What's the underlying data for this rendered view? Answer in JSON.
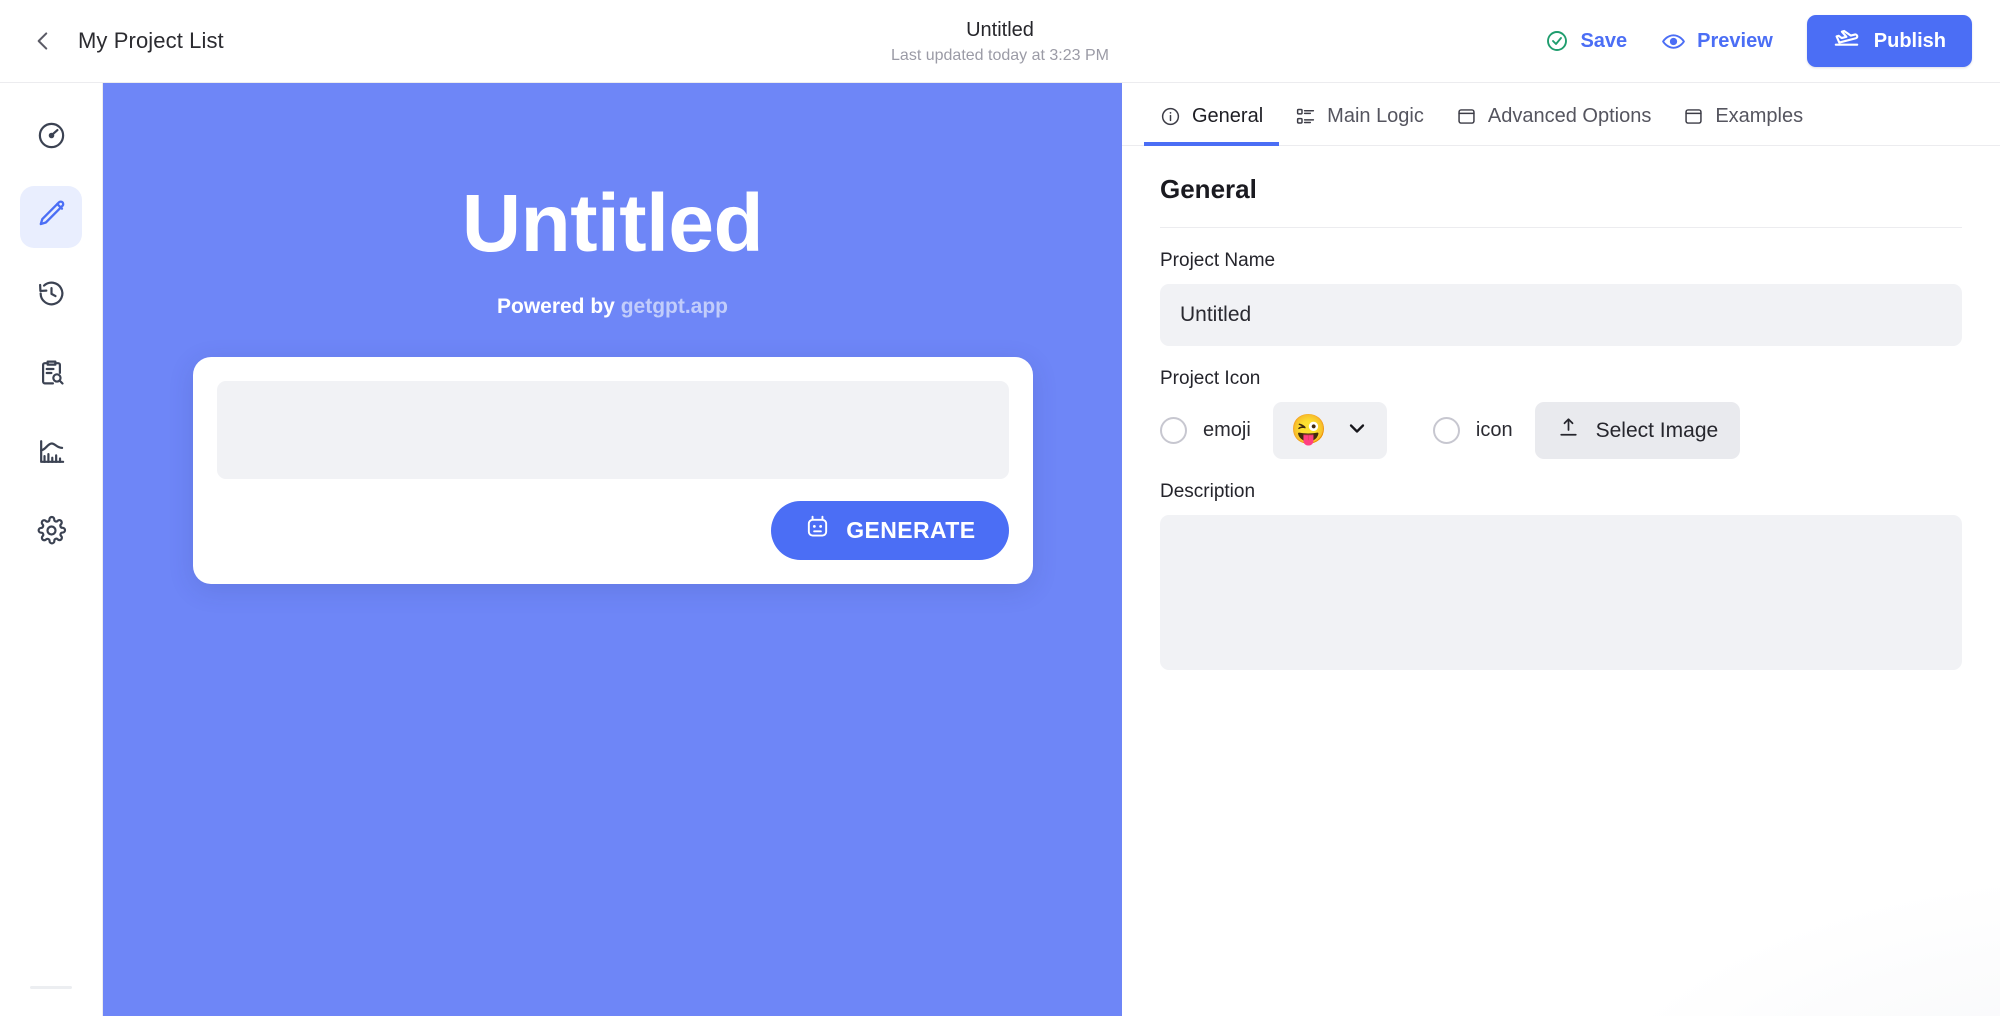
{
  "header": {
    "back_icon": "chevron-left-icon",
    "breadcrumb": "My Project List",
    "doc_title": "Untitled",
    "doc_subtitle": "Last updated today at 3:23 PM",
    "save_label": "Save",
    "save_icon": "check-circle-icon",
    "preview_label": "Preview",
    "preview_icon": "eye-icon",
    "publish_label": "Publish",
    "publish_icon": "plane-takeoff-icon",
    "accent_color": "#4b6ef5",
    "save_icon_color": "#1f9d6e"
  },
  "sidebar": {
    "items": [
      {
        "name": "dashboard",
        "icon": "speedometer-icon",
        "active": false
      },
      {
        "name": "editor",
        "icon": "pencil-icon",
        "active": true
      },
      {
        "name": "history",
        "icon": "clock-rewind-icon",
        "active": false
      },
      {
        "name": "logs",
        "icon": "clipboard-search-icon",
        "active": false
      },
      {
        "name": "analytics",
        "icon": "bar-chart-icon",
        "active": false
      },
      {
        "name": "settings",
        "icon": "gear-icon",
        "active": false
      }
    ],
    "active_bg": "#e9eefe",
    "active_fg": "#4b6ef5"
  },
  "preview": {
    "title": "Untitled",
    "powered_by_prefix": "Powered by ",
    "powered_by_brand": "getgpt.app",
    "prompt_value": "",
    "generate_label": "GENERATE",
    "generate_icon": "robot-icon",
    "background_color": "#6e86f7",
    "brand_color": "#c2cdfb"
  },
  "inspector": {
    "tabs": [
      {
        "label": "General",
        "icon": "info-circle-icon",
        "active": true
      },
      {
        "label": "Main Logic",
        "icon": "list-checks-icon",
        "active": false
      },
      {
        "label": "Advanced Options",
        "icon": "window-icon",
        "active": false
      },
      {
        "label": "Examples",
        "icon": "window-icon",
        "active": false
      }
    ],
    "section_title": "General",
    "project_name": {
      "label": "Project Name",
      "value": "Untitled",
      "placeholder": "Project Name"
    },
    "project_icon": {
      "label": "Project Icon",
      "emoji_radio_label": "emoji",
      "emoji_radio_selected": false,
      "emoji_value": "😜",
      "emoji_dropdown_icon": "chevron-down-icon",
      "icon_radio_label": "icon",
      "icon_radio_selected": false,
      "select_image_label": "Select Image",
      "select_image_icon": "upload-icon"
    },
    "description": {
      "label": "Description",
      "value": "",
      "placeholder": ""
    }
  }
}
